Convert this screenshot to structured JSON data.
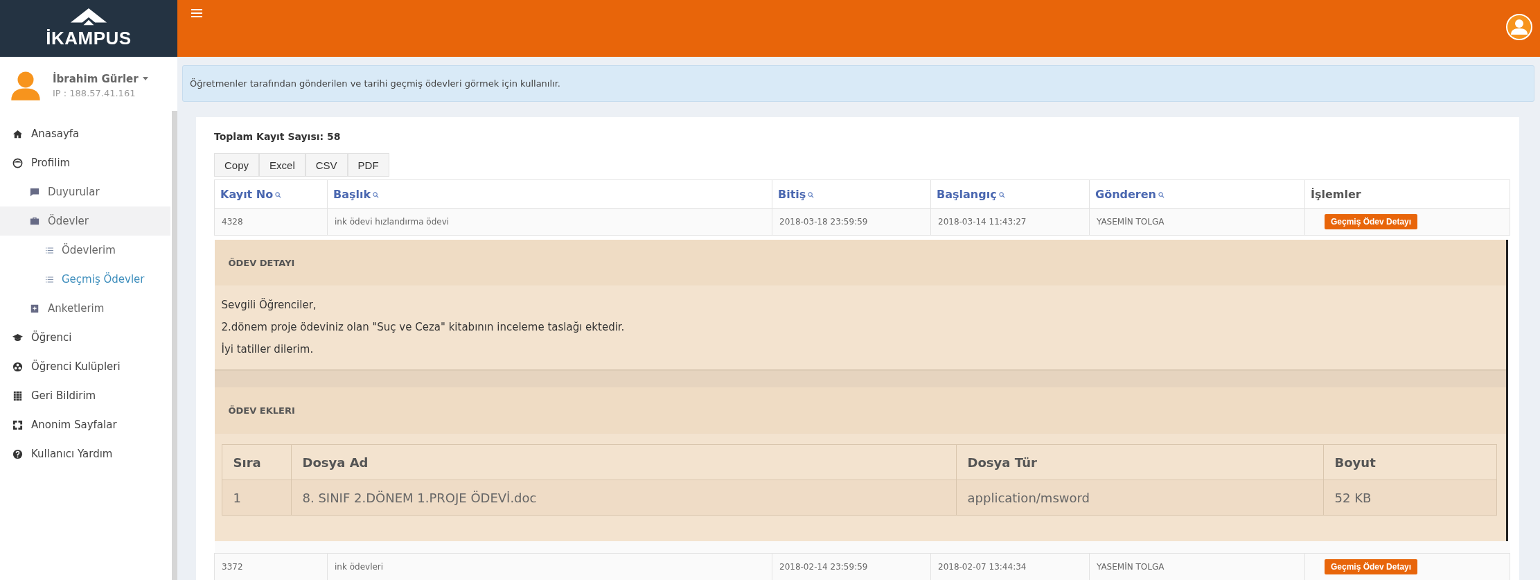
{
  "logo": {
    "text": "İKAMPUS"
  },
  "user": {
    "name": "İbrahim Gürler",
    "ip": "IP : 188.57.41.161"
  },
  "sidebar": {
    "items": [
      {
        "label": "Anasayfa",
        "selected": false,
        "highlighted": false
      },
      {
        "label": "Profilim",
        "selected": false,
        "highlighted": false,
        "children": [
          {
            "label": "Duyurular",
            "selected": false,
            "highlighted": false
          },
          {
            "label": "Ödevler",
            "selected": false,
            "highlighted": true,
            "children": [
              {
                "label": "Ödevlerim",
                "selected": false,
                "highlighted": false
              },
              {
                "label": "Geçmiş Ödevler",
                "selected": true,
                "highlighted": false
              }
            ]
          },
          {
            "label": "Anketlerim",
            "selected": false,
            "highlighted": false
          }
        ]
      },
      {
        "label": "Öğrenci",
        "selected": false,
        "highlighted": false
      },
      {
        "label": "Öğrenci Kulüpleri",
        "selected": false,
        "highlighted": false
      },
      {
        "label": "Geri Bildirim",
        "selected": false,
        "highlighted": false
      },
      {
        "label": "Anonim Sayfalar",
        "selected": false,
        "highlighted": false
      },
      {
        "label": "Kullanıcı Yardım",
        "selected": false,
        "highlighted": false
      }
    ]
  },
  "info": "Öğretmenler tarafından gönderilen ve tarihi geçmiş ödevleri görmek için kullanılır.",
  "total": "Toplam Kayıt Sayısı: 58",
  "export_buttons": [
    "Copy",
    "Excel",
    "CSV",
    "PDF"
  ],
  "table": {
    "columns": [
      {
        "label": "Kayıt No",
        "searchable": true
      },
      {
        "label": "Başlık",
        "searchable": true
      },
      {
        "label": "Bitiş",
        "searchable": true
      },
      {
        "label": "Başlangıç",
        "searchable": true
      },
      {
        "label": "Gönderen",
        "searchable": true
      },
      {
        "label": "İşlemler",
        "searchable": false
      }
    ],
    "rows": [
      {
        "cells": [
          "4328",
          "ink ödevi hızlandırma ödevi",
          "2018-03-18 23:59:59",
          "2018-03-14 11:43:27",
          "YASEMİN TOLGA"
        ],
        "action": "Geçmiş Ödev Detayı"
      },
      {
        "cells": [
          "3372",
          "ink ödevleri",
          "2018-02-14 23:59:59",
          "2018-02-07 13:44:34",
          "YASEMİN TOLGA"
        ],
        "action": "Geçmiş Ödev Detayı"
      }
    ]
  },
  "detail": {
    "title": "ÖDEV DETAYI",
    "message": [
      "Sevgili Öğrenciler,",
      "2.dönem proje ödeviniz olan \"Suç ve Ceza\" kitabının inceleme taslağı ektedir.",
      "İyi tatiller dilerim."
    ],
    "attachments_title": "ÖDEV EKLERI",
    "attachments": {
      "columns": [
        "Sıra",
        "Dosya Ad",
        "Dosya Tür",
        "Boyut"
      ],
      "rows": [
        [
          "1",
          "8. SINIF 2.DÖNEM 1.PROJE ÖDEVİ.doc",
          "application/msword",
          "52 KB"
        ]
      ]
    }
  }
}
